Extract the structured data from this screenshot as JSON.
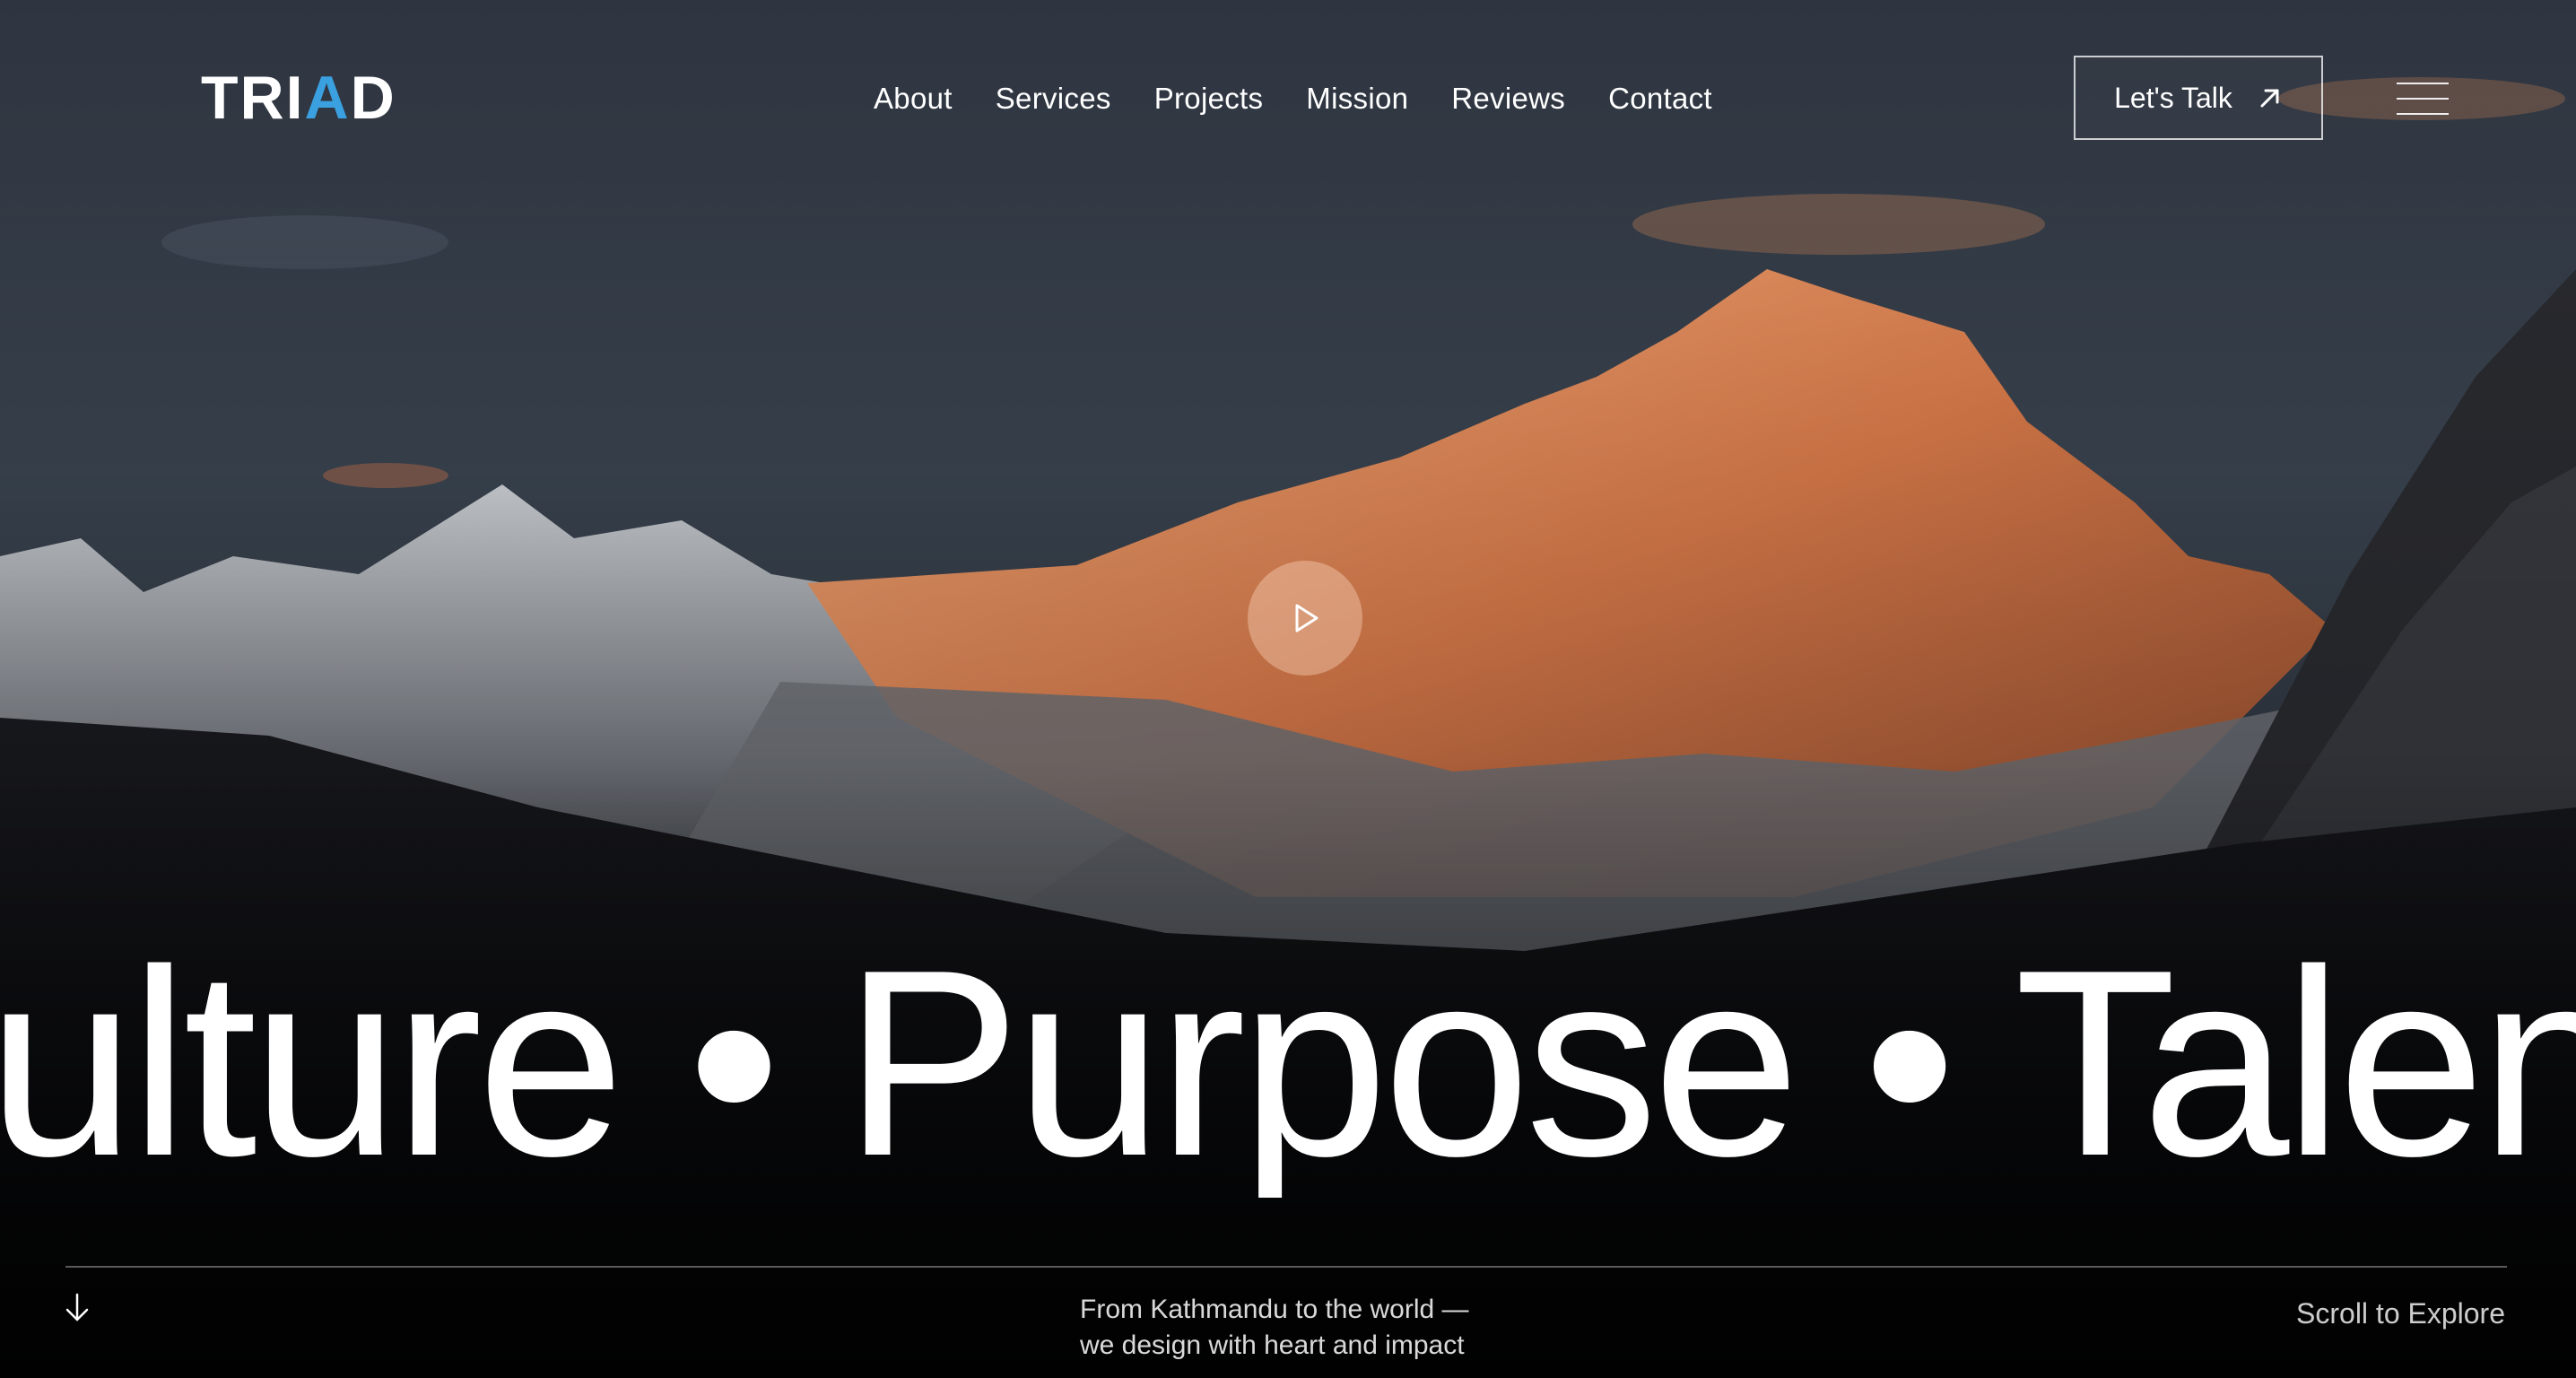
{
  "brand": {
    "logo_text_main": "TRI",
    "logo_text_accent": "A",
    "logo_text_end": "D",
    "accent_color": "#3aa0e0"
  },
  "nav": {
    "items": [
      "About",
      "Services",
      "Projects",
      "Mission",
      "Reviews",
      "Contact"
    ]
  },
  "cta": {
    "label": "Let's Talk",
    "icon": "arrow-up-right-icon"
  },
  "menu": {
    "icon": "hamburger-menu-icon"
  },
  "hero": {
    "play_icon": "play-icon",
    "marquee_text": "ulture • Purpose • Talent",
    "tagline_line1": "From Kathmandu to the world —",
    "tagline_line2": "we design with heart and impact",
    "scroll_hint": "Scroll to Explore",
    "scroll_icon": "arrow-down-icon"
  }
}
